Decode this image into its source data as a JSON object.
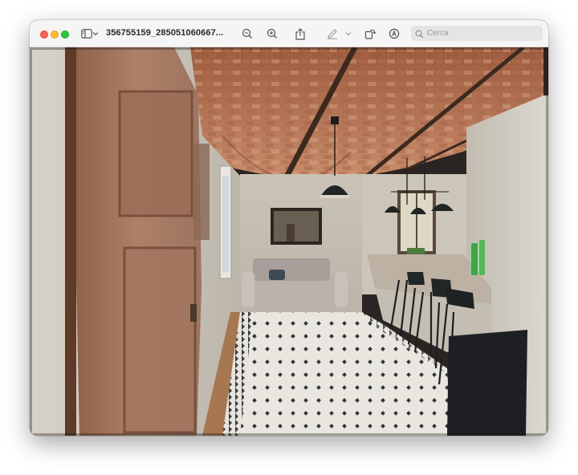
{
  "window": {
    "title": "356755159_285051060667...",
    "search": {
      "placeholder": "Cerca",
      "value": ""
    }
  },
  "toolbar": {
    "icons": [
      "sidebar-toggle-icon",
      "chevron-down-icon",
      "zoom-out-icon",
      "zoom-in-icon",
      "share-icon",
      "markup-pen-icon",
      "chevron-down-icon",
      "rotate-icon",
      "annotate-icon"
    ]
  },
  "image": {
    "subject": "room-photo"
  }
}
